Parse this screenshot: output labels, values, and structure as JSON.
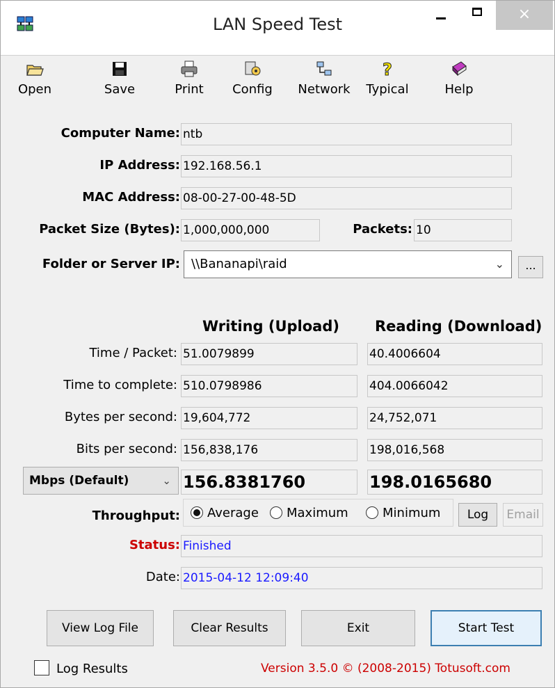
{
  "window": {
    "title": "LAN Speed Test"
  },
  "titlebar": {
    "close_glyph": "×"
  },
  "toolbar": {
    "items": [
      {
        "label": "Open",
        "icon": "open-folder-icon"
      },
      {
        "label": "Save",
        "icon": "floppy-disk-icon"
      },
      {
        "label": "Print",
        "icon": "printer-icon"
      },
      {
        "label": "Config",
        "icon": "config-icon"
      },
      {
        "label": "Network",
        "icon": "network-icon"
      },
      {
        "label": "Typical",
        "icon": "question-icon"
      },
      {
        "label": "Help",
        "icon": "help-book-icon"
      }
    ]
  },
  "info": {
    "computer_name_label": "Computer Name:",
    "computer_name": "ntb",
    "ip_label": "IP Address:",
    "ip": "192.168.56.1",
    "mac_label": "MAC Address:",
    "mac": "08-00-27-00-48-5D",
    "packet_size_label": "Packet Size (Bytes):",
    "packet_size": "1,000,000,000",
    "packets_label": "Packets:",
    "packets": "10",
    "folder_label": "Folder or Server IP:",
    "folder": "\\\\Bananapi\\raid",
    "browse_label": "..."
  },
  "results": {
    "write_header": "Writing (Upload)",
    "read_header": "Reading (Download)",
    "rows": [
      {
        "label": "Time / Packet:",
        "write": "51.0079899",
        "read": "40.4006604"
      },
      {
        "label": "Time to complete:",
        "write": "510.0798986",
        "read": "404.0066042"
      },
      {
        "label": "Bytes per second:",
        "write": "19,604,772",
        "read": "24,752,071"
      },
      {
        "label": "Bits per second:",
        "write": "156,838,176",
        "read": "198,016,568"
      }
    ],
    "unit_selected": "Mbps (Default)",
    "write_big": "156.8381760",
    "read_big": "198.0165680"
  },
  "throughput": {
    "label": "Throughput:",
    "options": [
      "Average",
      "Maximum",
      "Minimum"
    ],
    "selected": "Average",
    "log_label": "Log",
    "email_label": "Email"
  },
  "status": {
    "status_label": "Status:",
    "status_value": "Finished",
    "date_label": "Date:",
    "date_value": "2015-04-12 12:09:40"
  },
  "buttons": {
    "view_log": "View Log File",
    "clear": "Clear Results",
    "exit": "Exit",
    "start": "Start Test"
  },
  "footer": {
    "log_results": "Log Results",
    "version": "Version 3.5.0  © (2008-2015) Totusoft.com"
  },
  "colors": {
    "status_label": "#cc0000",
    "status_value": "#1a1aff",
    "footer": "#cc0000",
    "default_button_border": "#3c7fb1"
  }
}
